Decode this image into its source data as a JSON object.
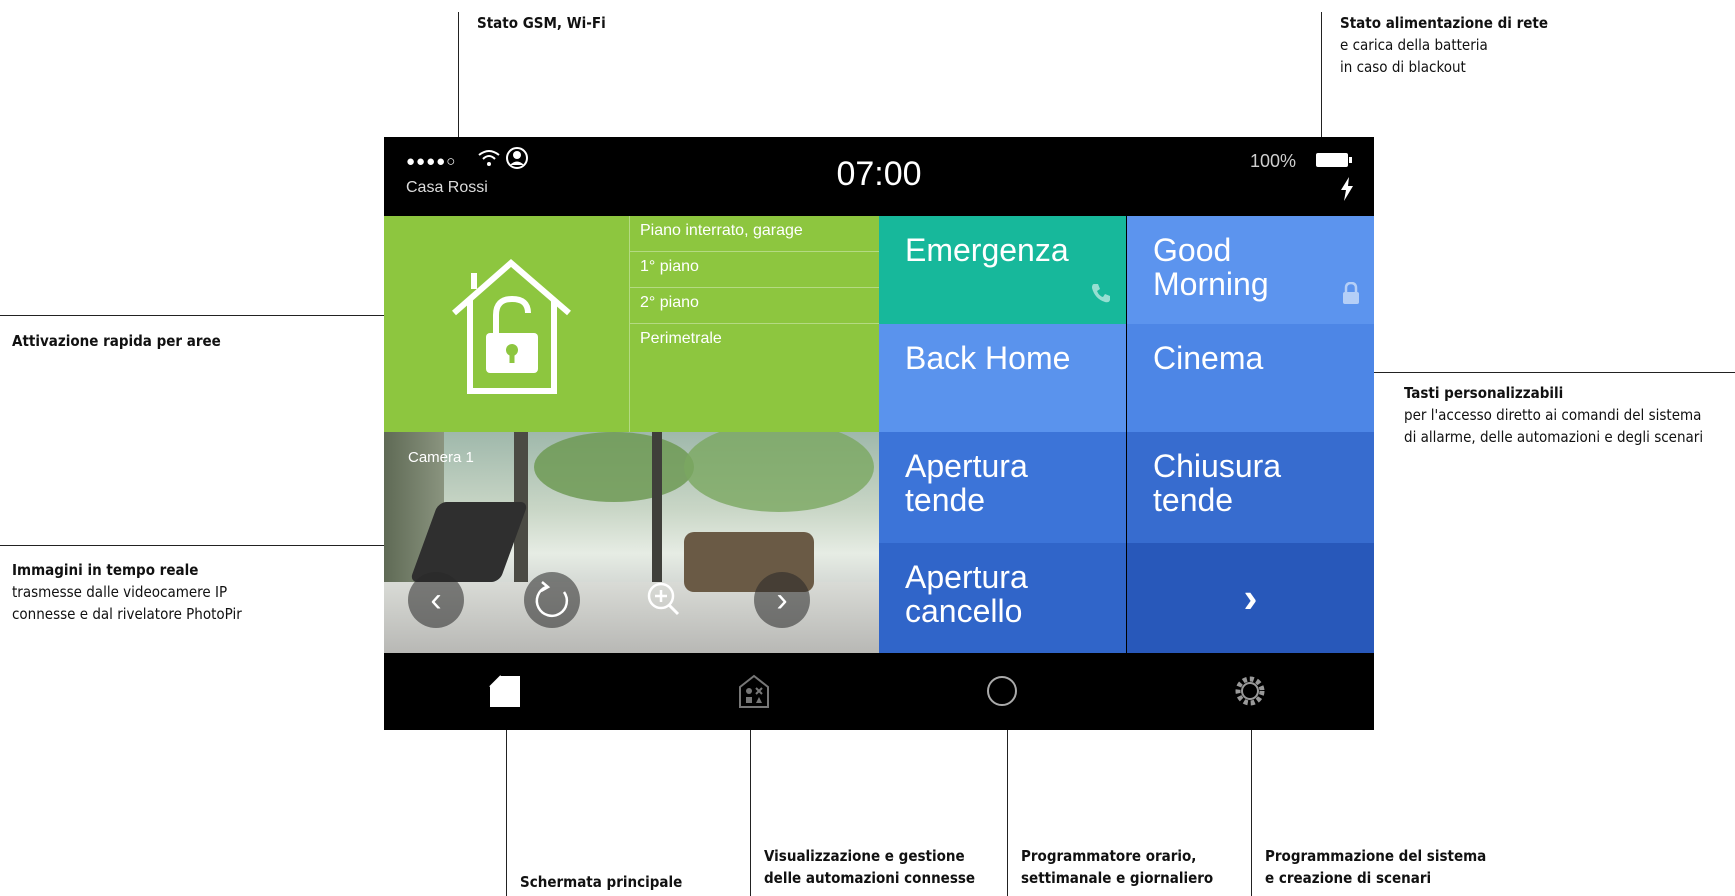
{
  "annotations": {
    "gsm": {
      "title": "Stato GSM, Wi-Fi"
    },
    "power": {
      "title": "Stato alimentazione di rete",
      "line1": "e carica della batteria",
      "line2": "in caso di blackout"
    },
    "areas": {
      "title": "Attivazione rapida per aree"
    },
    "camera": {
      "title": "Immagini in tempo reale",
      "line1": "trasmesse dalle videocamere IP",
      "line2": "connesse e dal rivelatore PhotoPir"
    },
    "custom": {
      "title": "Tasti personalizzabili",
      "line1": "per l'accesso diretto ai comandi del sistema",
      "line2": "di allarme, delle automazioni e degli scenari"
    },
    "home": {
      "title": "Schermata principale"
    },
    "automation": {
      "title": "Visualizzazione e gestione",
      "line2": "delle automazioni connesse"
    },
    "scheduler": {
      "title": "Programmatore orario,",
      "line2": "settimanale e giornaliero"
    },
    "settings": {
      "title": "Programmazione del sistema",
      "line2": "e creazione di scenari"
    }
  },
  "status": {
    "signal": "●●●●○",
    "home_name": "Casa Rossi",
    "time": "07:00",
    "battery": "100%"
  },
  "alarm": {
    "areas": [
      "Piano interrato, garage",
      "1° piano",
      "2° piano",
      "Perimetrale"
    ]
  },
  "camera": {
    "label": "Camera 1"
  },
  "tiles": [
    {
      "label": "Emergenza",
      "color": "#17b89b",
      "icon": "phone-icon"
    },
    {
      "label": "Good Morning",
      "color": "#5c94ee",
      "icon": "lock-icon"
    },
    {
      "label": "Back Home",
      "color": "#5a93ed"
    },
    {
      "label": "Cinema",
      "color": "#4d86e6"
    },
    {
      "label": "Apertura tende",
      "color": "#3c74d8"
    },
    {
      "label": "Chiusura tende",
      "color": "#376ccf"
    },
    {
      "label": "Apertura cancello",
      "color": "#3065c9"
    },
    {
      "label": "›",
      "color": "#2858ba"
    }
  ],
  "colors": {
    "alarm_green": "#8dc63f",
    "statusbar": "#000000"
  }
}
